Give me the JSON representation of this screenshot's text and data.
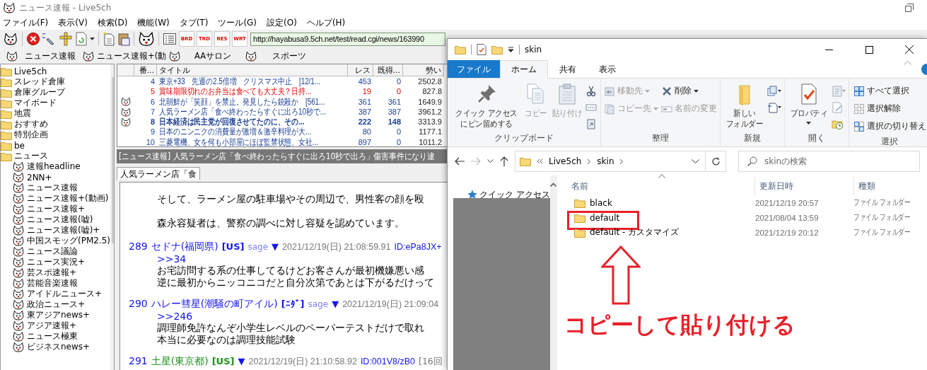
{
  "window": {
    "title": "ニュース速報 - Live5ch"
  },
  "menu": [
    "ファイル(F)",
    "表示(V)",
    "検索(D)",
    "機能(W)",
    "タブ(T)",
    "ツール(G)",
    "設定(O)",
    "ヘルプ(H)"
  ],
  "toolbar": {
    "text_buttons": [
      "BRD",
      "TRD",
      "RES",
      "WRT"
    ],
    "url": "http://hayabusa9.5ch.net/test/read.cgi/news/163990"
  },
  "board_tabs": [
    "ニュース速報",
    "ニュース速報+(動",
    "AAサロン",
    "スポーツ"
  ],
  "sidebar": {
    "items": [
      {
        "label": "Live5ch"
      },
      {
        "label": "スレッド倉庫"
      },
      {
        "label": "倉庫グループ"
      },
      {
        "label": "マイボード"
      },
      {
        "label": "地震"
      },
      {
        "label": "おすすめ"
      },
      {
        "label": "特別企画"
      },
      {
        "label": "be"
      },
      {
        "label": "ニュース",
        "children": [
          {
            "label": "速報headline"
          },
          {
            "label": "2NN+"
          },
          {
            "label": "ニュース速報"
          },
          {
            "label": "ニュース速報+(動画)"
          },
          {
            "label": "ニュース速報+"
          },
          {
            "label": "ニュース速報(嘘)"
          },
          {
            "label": "ニュース速報(嘘)+"
          },
          {
            "label": "中国スモッグ(PM2.5)"
          },
          {
            "label": "ニュース議論"
          },
          {
            "label": "ニュース実況+"
          },
          {
            "label": "芸スポ速報+"
          },
          {
            "label": "芸能音楽速報"
          },
          {
            "label": "アイドルニュース+"
          },
          {
            "label": "政治ニュース+"
          },
          {
            "label": "東アジアnews+"
          },
          {
            "label": "アジア速報+"
          },
          {
            "label": "ニュース極東"
          },
          {
            "label": "ビジネスnews+"
          }
        ]
      }
    ]
  },
  "thread_list": {
    "columns": [
      "番...",
      "タイトル",
      "レス",
      "既得...",
      "勢い"
    ],
    "rows": [
      {
        "logged": false,
        "kind": "normal",
        "number": "4",
        "title": "東京+33　先週の2.5倍増　クリスマス中止　[12/1...",
        "res": "453",
        "got": "0",
        "momentum": "2502.8"
      },
      {
        "logged": false,
        "kind": "warning",
        "number": "5",
        "title": "賞味期限切れのお弁当は食べても大丈夫？日持...",
        "res": "19",
        "got": "0",
        "momentum": "827.8"
      },
      {
        "logged": true,
        "kind": "normal",
        "number": "6",
        "title": "北朝鮮が「笑顔」を禁止。発見したら銃殺か　[561...",
        "res": "361",
        "got": "361",
        "momentum": "1649.9"
      },
      {
        "logged": true,
        "kind": "normal",
        "number": "7",
        "title": "人気ラーメン店「食べ終わったらすぐに出ろ10秒で...",
        "res": "387",
        "got": "387",
        "momentum": "3961.2"
      },
      {
        "logged": true,
        "kind": "updated",
        "number": "8",
        "title": "日本経済は民主党が回復させてたのに、その...",
        "res": "222",
        "got": "148",
        "momentum": "3313.9"
      },
      {
        "logged": false,
        "kind": "normal",
        "number": "9",
        "title": "日本のニンニクの消費量が激増＆激辛料理が大...",
        "res": "80",
        "got": "0",
        "momentum": "1177.1"
      },
      {
        "logged": false,
        "kind": "normal",
        "number": "10",
        "title": "三菱電機、女を何も小部屋にほぼ監禁状態、女社...",
        "res": "897",
        "got": "0",
        "momentum": "1011.2"
      }
    ]
  },
  "thread_title": "[ニュース速報] 人気ラーメン店「食べ終わったらすぐに出ろ10秒で出ろ」傷害事件になり逮",
  "thread_tabs": [
    {
      "label": "人気ラーメン店「食",
      "selected": true
    }
  ],
  "article_lines": [
    "そして、ラーメン屋の駐車場やその周辺で、男性客の顔を殴",
    "森永容疑者は、警察の調べに対し容疑を認めています。"
  ],
  "posts": [
    {
      "number": "289",
      "name": "セドナ(福岡県)",
      "color": "#1414f0",
      "tag": "[US]",
      "mail": "sage",
      "marker": "▼",
      "date": "2021/12/19(日) 21:08:59.91",
      "id": "ID:ePa8JX+",
      "reply": ">>34",
      "body": [
        "お宅訪問する系の仕事してるけどお客さんが最初機嫌悪い感",
        "逆に最初からニッコニコだと自分次第であとは下がるだけって"
      ]
    },
    {
      "number": "290",
      "name": "ハレー彗星(潮騒の町アイル)",
      "color": "#1414f0",
      "tag": "[ﾆﾀﾞ]",
      "mail": "sage",
      "marker": "▼",
      "date": "2021/12/19(日) 21:09:04",
      "reply": ">>246",
      "body": [
        "調理師免許なんぞ小学生レベルのペーパーテストだけで取れ",
        "本当に必要なのは調理技能試験"
      ]
    },
    {
      "number": "291",
      "name": "土星(東京都)",
      "color": "#1f8f1f",
      "tag": "[US]",
      "marker": "▼",
      "date": "2021/12/19(日) 21:10:58.92",
      "id": "ID:001V8/zB0",
      "extra": "[16回"
    }
  ],
  "explorer": {
    "title": "skin",
    "ribbon_tabs": [
      {
        "label": "ファイル",
        "kind": "menu",
        "selected": false
      },
      {
        "label": "ホーム",
        "kind": "tab",
        "selected": true
      },
      {
        "label": "共有",
        "kind": "tab",
        "selected": false
      },
      {
        "label": "表示",
        "kind": "tab",
        "selected": false
      }
    ],
    "ribbon_groups": [
      {
        "label": "クリップボード",
        "buttons": [
          {
            "label": [
              "クイック アクセス",
              "にピン留めする"
            ],
            "kind": "large",
            "disabled": false,
            "dropdown": false
          },
          {
            "label": "コピー",
            "kind": "large",
            "disabled": true,
            "dropdown": false
          },
          {
            "label": "貼り付け",
            "kind": "large",
            "disabled": true,
            "dropdown": false
          }
        ]
      },
      {
        "label": "整理",
        "buttons": [
          {
            "label": "移動先",
            "kind": "small",
            "disabled": true,
            "dropdown": true
          },
          {
            "label": "コピー先",
            "kind": "small",
            "disabled": true,
            "dropdown": true
          },
          {
            "label": "削除",
            "kind": "small",
            "disabled": false,
            "dropdown": true
          },
          {
            "label": "名前の変更",
            "kind": "small",
            "disabled": true,
            "dropdown": false
          }
        ]
      },
      {
        "label": "新規",
        "buttons": [
          {
            "label": [
              "新しい",
              "フォルダー"
            ],
            "kind": "large",
            "disabled": false,
            "dropdown": false
          }
        ]
      },
      {
        "label": "開く",
        "buttons": [
          {
            "label": "プロパティ",
            "kind": "large",
            "disabled": false,
            "dropdown": true
          }
        ]
      },
      {
        "label": "選択",
        "buttons": [
          {
            "label": "すべて選択",
            "kind": "small",
            "disabled": false,
            "dropdown": false
          },
          {
            "label": "選択解除",
            "kind": "small",
            "disabled": false,
            "dropdown": false
          },
          {
            "label": "選択の切り替え",
            "kind": "small",
            "disabled": false,
            "dropdown": false
          }
        ]
      }
    ],
    "address": {
      "path": [
        "Live5ch",
        "skin"
      ]
    },
    "search": {
      "placeholder": "skinの検索"
    },
    "nav_pane": {
      "items": [
        {
          "label": "クイック アクセス"
        }
      ]
    },
    "columns": [
      "名前",
      "更新日時",
      "種類"
    ],
    "files": [
      {
        "name": "black",
        "modified": "2021/12/19 20:57",
        "type": "ファイル フォルダー",
        "highlighted": false
      },
      {
        "name": "default",
        "modified": "2021/08/04 13:59",
        "type": "ファイル フォルダー",
        "highlighted": true
      },
      {
        "name": "default - カスタマイズ",
        "modified": "2021/12/19 20:12",
        "type": "ファイル フォルダー",
        "highlighted": false
      }
    ]
  },
  "annotation": {
    "text": "コピーして貼り付ける"
  }
}
